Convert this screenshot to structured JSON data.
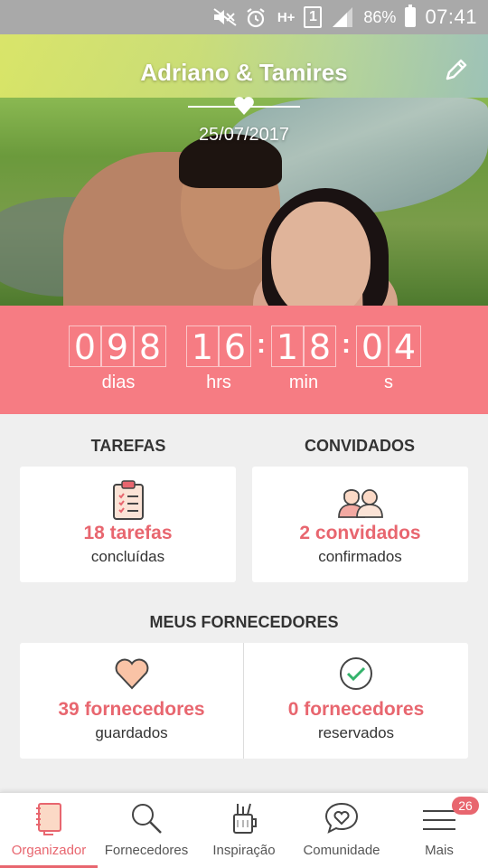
{
  "status_bar": {
    "battery": "86%",
    "time": "07:41",
    "network": "H+",
    "sim": "1",
    "icons": [
      "mute-icon",
      "alarm-icon",
      "network-icon",
      "sim-icon",
      "signal-icon",
      "battery-icon"
    ]
  },
  "hero": {
    "couple_name": "Adriano & Tamires",
    "date": "25/07/2017",
    "edit_icon": "pencil-icon"
  },
  "countdown": {
    "days": [
      "0",
      "9",
      "8"
    ],
    "hours": [
      "1",
      "6"
    ],
    "minutes": [
      "1",
      "8"
    ],
    "seconds": [
      "0",
      "4"
    ],
    "labels": {
      "days": "dias",
      "hours": "hrs",
      "minutes": "min",
      "seconds": "s"
    }
  },
  "tasks": {
    "title": "TAREFAS",
    "count_label": "18 tarefas",
    "sub_label": "concluídas",
    "icon": "clipboard-icon"
  },
  "guests": {
    "title": "CONVIDADOS",
    "count_label": "2 convidados",
    "sub_label": "confirmados",
    "icon": "couple-icon"
  },
  "vendors": {
    "title": "MEUS FORNECEDORES",
    "saved": {
      "count_label": "39 fornecedores",
      "sub_label": "guardados",
      "icon": "heart-icon"
    },
    "booked": {
      "count_label": "0 fornecedores",
      "sub_label": "reservados",
      "icon": "check-circle-icon"
    }
  },
  "bottom_nav": {
    "items": [
      {
        "label": "Organizador",
        "icon": "notebook-icon",
        "active": true
      },
      {
        "label": "Fornecedores",
        "icon": "search-icon"
      },
      {
        "label": "Inspiração",
        "icon": "pens-cup-icon"
      },
      {
        "label": "Comunidade",
        "icon": "chat-heart-icon"
      },
      {
        "label": "Mais",
        "icon": "menu-icon",
        "badge": "26"
      }
    ]
  },
  "colors": {
    "accent": "#e8666f",
    "countdown_bg": "#f67c83",
    "status_bar": "#a9a9a9",
    "background": "#efefef"
  }
}
